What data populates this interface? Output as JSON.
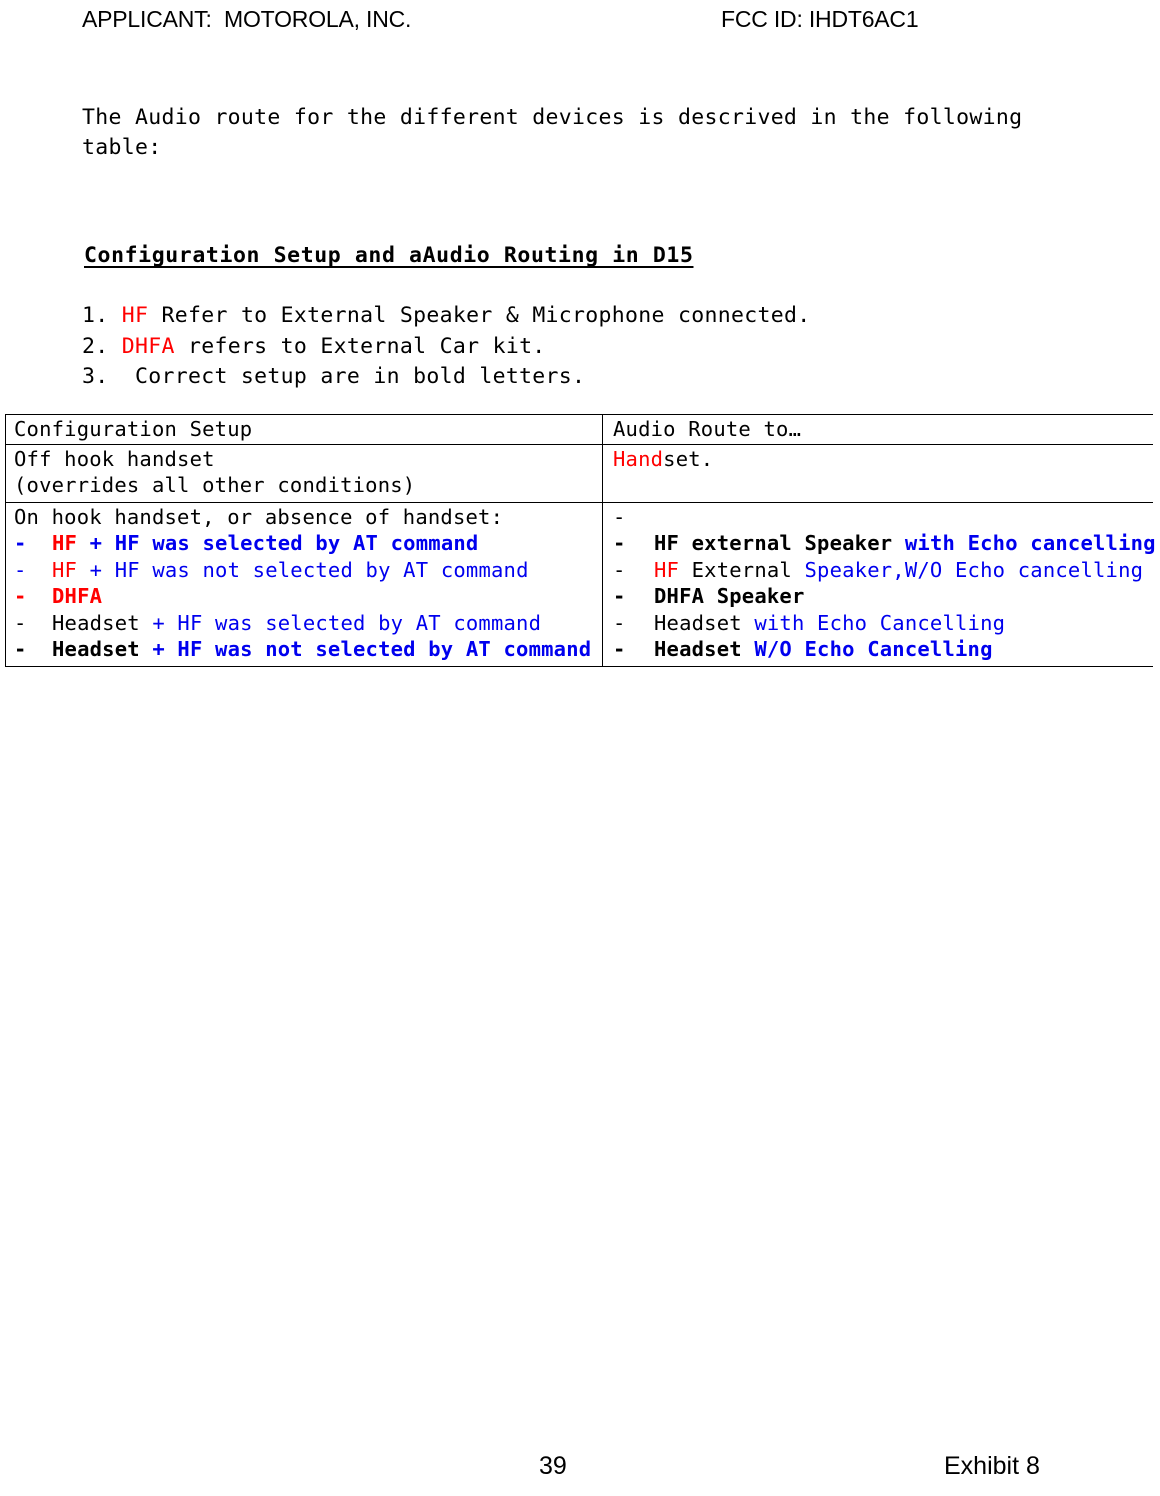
{
  "header": {
    "applicant": "APPLICANT:  MOTOROLA, INC.",
    "fcc_id": "FCC ID: IHDT6AC1"
  },
  "intro": {
    "paragraph": "The Audio route for the different devices is descrived in the following table:"
  },
  "section": {
    "heading": "Configuration Setup and aAudio Routing in D15"
  },
  "notes": [
    {
      "number": "1.",
      "red": "HF",
      "rest": " Refer to External Speaker & Microphone connected."
    },
    {
      "number": "2.",
      "red": "DHFA",
      "rest": " refers to External Car kit."
    },
    {
      "number": "3.",
      "red": "",
      "rest": " Correct setup are in bold letters."
    }
  ],
  "table": {
    "columns": {
      "left_header": "Configuration Setup",
      "right_header": "Audio Route to…"
    },
    "rows": [
      {
        "left": {
          "lines": [
            "Off hook handset",
            "(overrides all other conditions)"
          ]
        },
        "right": {
          "red_prefix": "Hand",
          "black_suffix": "set."
        }
      },
      {
        "left": {
          "intro": "On hook handset, or absence of handset:",
          "bullets": [
            {
              "dash": "-",
              "dash_color": "blue",
              "bold": true,
              "segments": [
                {
                  "text": "HF",
                  "color": "red"
                },
                {
                  "text": " + HF was selected by AT command",
                  "color": "blue"
                }
              ]
            },
            {
              "dash": "-",
              "dash_color": "blue",
              "bold": false,
              "segments": [
                {
                  "text": "HF",
                  "color": "red"
                },
                {
                  "text": " + HF was not selected by AT command",
                  "color": "blue"
                }
              ]
            },
            {
              "dash": "-",
              "dash_color": "red",
              "bold": true,
              "segments": [
                {
                  "text": "DHFA",
                  "color": "red"
                }
              ]
            },
            {
              "dash": "-",
              "dash_color": "black",
              "bold": false,
              "segments": [
                {
                  "text": "Headset",
                  "color": "black"
                },
                {
                  "text": " + HF was selected by AT command",
                  "color": "blue"
                }
              ]
            },
            {
              "dash": "-",
              "dash_color": "black",
              "bold": true,
              "segments": [
                {
                  "text": "Headset",
                  "color": "black"
                },
                {
                  "text": " + HF was not selected by AT command",
                  "color": "blue"
                }
              ]
            }
          ]
        },
        "right": {
          "bullets": [
            {
              "dash": "-",
              "dash_color": "black",
              "bold": false,
              "segments": []
            },
            {
              "dash": "-",
              "dash_color": "black",
              "bold": true,
              "segments": [
                {
                  "text": "HF external Speaker",
                  "color": "black"
                },
                {
                  "text": " with Echo cancelling",
                  "color": "blue"
                }
              ]
            },
            {
              "dash": "-",
              "dash_color": "black",
              "bold": false,
              "segments": [
                {
                  "text": "HF",
                  "color": "red"
                },
                {
                  "text": " External ",
                  "color": "black"
                },
                {
                  "text": "Speaker,W/O Echo cancelling",
                  "color": "blue"
                }
              ]
            },
            {
              "dash": "-",
              "dash_color": "black",
              "bold": true,
              "segments": [
                {
                  "text": "DHFA Speaker",
                  "color": "black"
                }
              ]
            },
            {
              "dash": "-",
              "dash_color": "black",
              "bold": false,
              "segments": [
                {
                  "text": "Headset",
                  "color": "black"
                },
                {
                  "text": " with Echo Cancelling",
                  "color": "blue"
                }
              ]
            },
            {
              "dash": "-",
              "dash_color": "black",
              "bold": true,
              "segments": [
                {
                  "text": "Headset",
                  "color": "black"
                },
                {
                  "text": " W/O Echo Cancelling",
                  "color": "blue"
                }
              ]
            }
          ]
        }
      }
    ]
  },
  "footer": {
    "page_number": "39",
    "exhibit": "Exhibit 8"
  },
  "colors": {
    "red": "#ff0000",
    "blue": "#0000ee",
    "black": "#000000"
  }
}
